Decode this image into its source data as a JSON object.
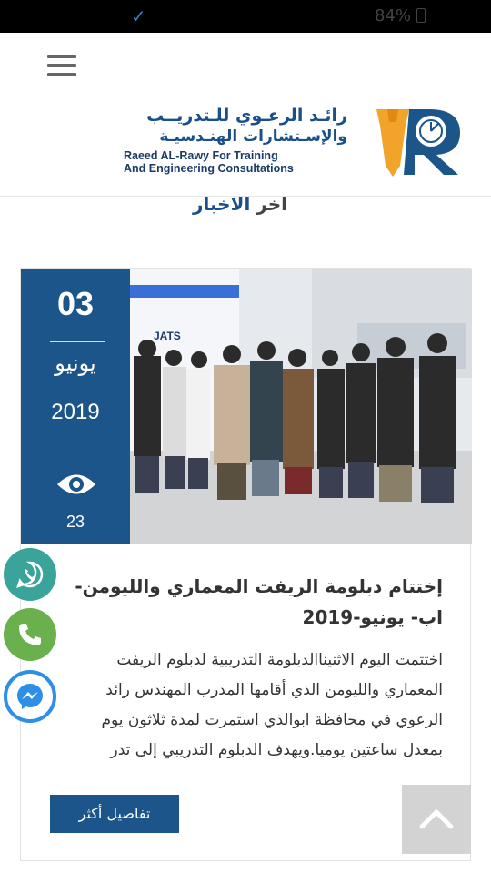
{
  "status_bar": {
    "battery": "84%",
    "check_icon": "check-icon"
  },
  "header": {
    "logo": {
      "ar_line1": "رائـد الرعـوي للـتدريــب",
      "ar_line2": "والإسـتشارات الهنـدسيـة",
      "en_line1": "Raeed AL-Rawy For Training",
      "en_line2": "And Engineering Consultations"
    }
  },
  "section": {
    "title_prefix": "اخر ",
    "title_accent": "الاخبار"
  },
  "post": {
    "date_day": "03",
    "date_month": "يونيو",
    "date_year": "2019",
    "views": "23",
    "title": "إختتام دبلومة الريفت المعماري والليومن-اب- يونيو-2019",
    "excerpt_lines": [
      "اختتمت اليوم الاثنيناالدبلومة التدريبية لدبلوم الريفت",
      "المعماري والليومن الذي أقامها المدرب المهندس رائد",
      "الرعوي في محافظة ابوالذي استمرت لمدة ثلاثون يوم",
      "بمعدل ساعتين يوميا.ويهدف الدبلوم التدريبي إلى تدر"
    ],
    "more_label": "تفاصيل أكثر",
    "photo_sign": "JATS"
  },
  "colors": {
    "brand_blue": "#1b5589",
    "whatsapp": "#3aa39a",
    "phone": "#6ab04c",
    "messenger": "#2d8fe6",
    "logo_orange": "#f2a32a"
  }
}
